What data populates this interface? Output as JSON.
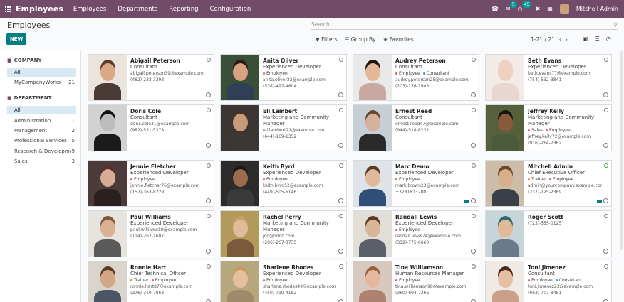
{
  "navbar": {
    "app_name": "Employees",
    "menus": [
      "Employees",
      "Departments",
      "Reporting",
      "Configuration"
    ],
    "chat_badge": "5",
    "activity_badge": "45",
    "user_name": "Mitchell Admin"
  },
  "control": {
    "title": "Employees",
    "search_placeholder": "Search...",
    "new_label": "NEW",
    "filters_label": "Filters",
    "groupby_label": "Group By",
    "favorites_label": "Favorites",
    "pager": "1-21 / 21"
  },
  "sidebar": {
    "company_head": "COMPANY",
    "company_items": [
      {
        "label": "All",
        "count": ""
      },
      {
        "label": "MyCompanyWorks",
        "count": "21"
      }
    ],
    "dept_head": "DEPARTMENT",
    "dept_items": [
      {
        "label": "All",
        "count": ""
      },
      {
        "label": "Administration",
        "count": "1"
      },
      {
        "label": "Management",
        "count": "2"
      },
      {
        "label": "Professional Services",
        "count": "5"
      },
      {
        "label": "Research & Development",
        "count": "9"
      },
      {
        "label": "Sales",
        "count": "3"
      }
    ]
  },
  "colors": {
    "brand": "#714b67",
    "accent": "#017e84",
    "tag_employee": "#e05f5f",
    "tag_consultant": "#2f9fd6",
    "tag_trainer": "#e08a2e",
    "tag_sales": "#e05f5f"
  },
  "employees": [
    {
      "name": "Abigail Peterson",
      "job": "Consultant",
      "tags": [],
      "email": "abigail.peterson39@example.com",
      "phone": "(482)-233-3393",
      "online": false,
      "chat": false,
      "bg": "#ebe4dc",
      "skin": "#d9a987",
      "cloth": "#4a3b36",
      "hair": "#5a3a28"
    },
    {
      "name": "Anita Oliver",
      "job": "Experienced Developer",
      "tags": [
        "Employee"
      ],
      "email": "anita.oliver32@example.com",
      "phone": "(538)-497-4804",
      "online": false,
      "chat": false,
      "bg": "#3a4f3a",
      "skin": "#d7a27f",
      "cloth": "#2f3f55",
      "hair": "#2a1a12"
    },
    {
      "name": "Audrey Peterson",
      "job": "Consultant",
      "tags": [
        "Employee",
        "Consultant"
      ],
      "email": "audrey.peterson25@example.com",
      "phone": "(203)-276-7903",
      "online": false,
      "chat": false,
      "bg": "#e9e9e9",
      "skin": "#e2b899",
      "cloth": "#c8a9a2",
      "hair": "#1b1410"
    },
    {
      "name": "Beth Evans",
      "job": "Experienced Developer",
      "tags": [],
      "email": "beth.evans77@example.com",
      "phone": "(754)-532-3841",
      "online": false,
      "chat": false,
      "bg": "#f3ebe8",
      "skin": "#efcfc0",
      "cloth": "#e9d6d0",
      "hair": "#ecd3c6"
    },
    {
      "name": "Doris Cole",
      "job": "Consultant",
      "tags": [],
      "email": "doris.cole31@example.com",
      "phone": "(982)-531-5378",
      "online": false,
      "chat": false,
      "bg": "#d2d2d2",
      "skin": "#bdbdbd",
      "cloth": "#1b1b1b",
      "hair": "#111111"
    },
    {
      "name": "Eli Lambert",
      "job": "Marketing and Community Manager",
      "tags": [],
      "email": "eli.lambert22@example.com",
      "phone": "(644)-169-1352",
      "online": false,
      "chat": false,
      "bg": "#3b3632",
      "skin": "#c99a7c",
      "cloth": "#3a3836",
      "hair": "#4a3222"
    },
    {
      "name": "Ernest Reed",
      "job": "Consultant",
      "tags": [],
      "email": "ernest.reed47@example.com",
      "phone": "(944)-518-8232",
      "online": false,
      "chat": false,
      "bg": "#c7ced6",
      "skin": "#d6b19a",
      "cloth": "#2a2a2a",
      "hair": "#6b4a32"
    },
    {
      "name": "Jeffrey Kelly",
      "job": "Marketing and Community Manager",
      "tags": [
        "Sales",
        "Employee"
      ],
      "email": "jeffrey.kelly72@example.com",
      "phone": "(916)-264-7362",
      "online": false,
      "chat": false,
      "bg": "#56603a",
      "skin": "#8a5a3c",
      "cloth": "#4a5a3a",
      "hair": "#1a120c"
    },
    {
      "name": "Jennie Fletcher",
      "job": "Experienced Developer",
      "tags": [
        "Employee"
      ],
      "email": "jennie.fletcher76@example.com",
      "phone": "(157)-363-8229",
      "online": false,
      "chat": false,
      "bg": "#4d3a3a",
      "skin": "#d7ad95",
      "cloth": "#2a2020",
      "hair": "#5a2e2a"
    },
    {
      "name": "Keith Byrd",
      "job": "Experienced Developer",
      "tags": [
        "Employee"
      ],
      "email": "keith.byrd52@example.com",
      "phone": "(449)-505-5146",
      "online": false,
      "chat": false,
      "bg": "#2c2c2c",
      "skin": "#9d6b4e",
      "cloth": "#3a3a3a",
      "hair": "#1a1a1a"
    },
    {
      "name": "Marc Demo",
      "job": "Experienced Developer",
      "tags": [
        "Employee"
      ],
      "email": "mark.brown23@example.com",
      "phone": "+3281813700",
      "online": false,
      "chat": true,
      "bg": "#dfe3e8",
      "skin": "#e0b99c",
      "cloth": "#2f4f79",
      "hair": "#5a3b22"
    },
    {
      "name": "Mitchell Admin",
      "job": "Chief Executive Officer",
      "tags": [
        "Trainer",
        "Employee"
      ],
      "email": "admin@yourcompany.example.com",
      "phone": "(237)-125-2389",
      "online": true,
      "chat": true,
      "bg": "#cbbda8",
      "skin": "#d9ae8b",
      "cloth": "#3a3f48",
      "hair": "#6b4a2c"
    },
    {
      "name": "Paul Williams",
      "job": "Experienced Developer",
      "tags": [],
      "email": "paul.williams59@example.com",
      "phone": "(114)-262-1607",
      "online": false,
      "chat": false,
      "bg": "#e7e3df",
      "skin": "#d8b094",
      "cloth": "#5a5a5a",
      "hair": "#7a5a3a"
    },
    {
      "name": "Rachel Perry",
      "job": "Marketing and Community Manager",
      "tags": [],
      "email": "jod@odoo.com",
      "phone": "(206)-267-3735",
      "online": false,
      "chat": false,
      "bg": "#b39a5a",
      "skin": "#e0bb9c",
      "cloth": "#7a5a3a",
      "hair": "#c6a263"
    },
    {
      "name": "Randall Lewis",
      "job": "Experienced Developer",
      "tags": [
        "Employee"
      ],
      "email": "randall.lewis74@example.com",
      "phone": "(332)-775-6660",
      "online": false,
      "chat": false,
      "bg": "#e0ded6",
      "skin": "#d8b597",
      "cloth": "#5a5f6a",
      "hair": "#5a3b24"
    },
    {
      "name": "Roger Scott",
      "job": "",
      "tags": [],
      "email": "",
      "phone": "(723)-555-0125",
      "online": false,
      "chat": false,
      "bg": "#c8d5d8",
      "skin": "#e2b896",
      "cloth": "#6a7a8a",
      "hair": "#2a6f6f"
    },
    {
      "name": "Ronnie Hart",
      "job": "Chief Technical Officer",
      "tags": [
        "Trainer",
        "Employee"
      ],
      "email": "ronnie.hart87@example.com",
      "phone": "(376)-310-7863",
      "online": false,
      "chat": false,
      "bg": "#d9d4cc",
      "skin": "#d2a787",
      "cloth": "#4a5666",
      "hair": "#5a3a22"
    },
    {
      "name": "Sharlene Rhodes",
      "job": "Experienced Developer",
      "tags": [
        "Employee"
      ],
      "email": "sharlene.rhodes49@example.com",
      "phone": "(450)-719-4182",
      "online": false,
      "chat": false,
      "bg": "#b7a77d",
      "skin": "#e5c0a0",
      "cloth": "#a08a6a",
      "hair": "#c59a5e"
    },
    {
      "name": "Tina Williamson",
      "job": "Human Resources Manager",
      "tags": [
        "Employee"
      ],
      "email": "tina.williamson98@example.com",
      "phone": "(360)-694-7266",
      "online": false,
      "chat": false,
      "bg": "#d8c9c0",
      "skin": "#e3b89c",
      "cloth": "#b08070",
      "hair": "#9a5f3a"
    },
    {
      "name": "Toni Jimenez",
      "job": "Consultant",
      "tags": [
        "Employee",
        "Consultant"
      ],
      "email": "toni.jimenez23@example.com",
      "phone": "(663)-707-8451",
      "online": false,
      "chat": false,
      "bg": "#efeae6",
      "skin": "#e6bea2",
      "cloth": "#caa08a",
      "hair": "#4a2a1a"
    }
  ]
}
